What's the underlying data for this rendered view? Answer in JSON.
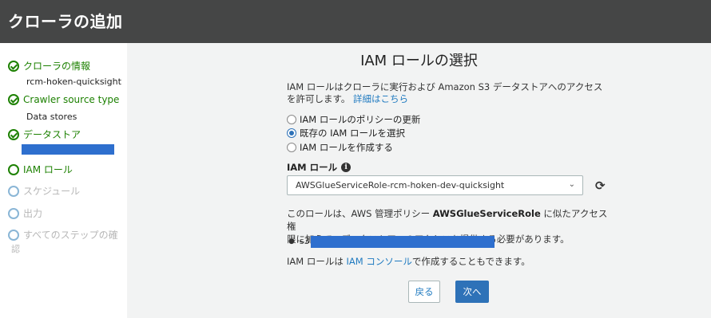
{
  "header": {
    "title": "クローラの追加"
  },
  "sidebar": {
    "steps": [
      {
        "label": "クローラの情報",
        "sub": "rcm-hoken-quicksight"
      },
      {
        "label": "Crawler source type",
        "sub": "Data stores"
      },
      {
        "label": "データストア"
      },
      {
        "label": "IAM ロール"
      },
      {
        "label": "スケジュール"
      },
      {
        "label": "出力"
      },
      {
        "label": "すべてのステップの確",
        "label2": "認"
      }
    ]
  },
  "main": {
    "title": "IAM ロールの選択",
    "desc_line1": "IAM ロールはクローラに実行および Amazon S3 データストアへのアクセス",
    "desc_line2": "を許可します。",
    "desc_link": "詳細はこちら",
    "radios": [
      {
        "label": "IAM ロールのポリシーの更新",
        "selected": false
      },
      {
        "label": "既存の IAM ロールを選択",
        "selected": true
      },
      {
        "label": "IAM ロールを作成する",
        "selected": false
      }
    ],
    "role_label": "IAM ロール",
    "role_value": "AWSGlueServiceRole-rcm-hoken-dev-quicksight",
    "policy_pre": "このロールは、AWS 管理ポリシー ",
    "policy_bold": "AWSGlueServiceRole",
    "policy_post": " に似たアクセス権",
    "policy_line2": "限に加えて、データストアへのアクセスを提供する必要があります。",
    "bullet_prefix": "s3:",
    "console_pre": "IAM ロールは ",
    "console_link": "IAM コンソール",
    "console_post": "で作成することもできます。",
    "back_label": "戻る",
    "next_label": "次へ"
  },
  "colors": {
    "header_bg": "#454646",
    "accent": "#2e72b8",
    "done_green": "#1d8102",
    "redaction": "#2e6fce"
  }
}
